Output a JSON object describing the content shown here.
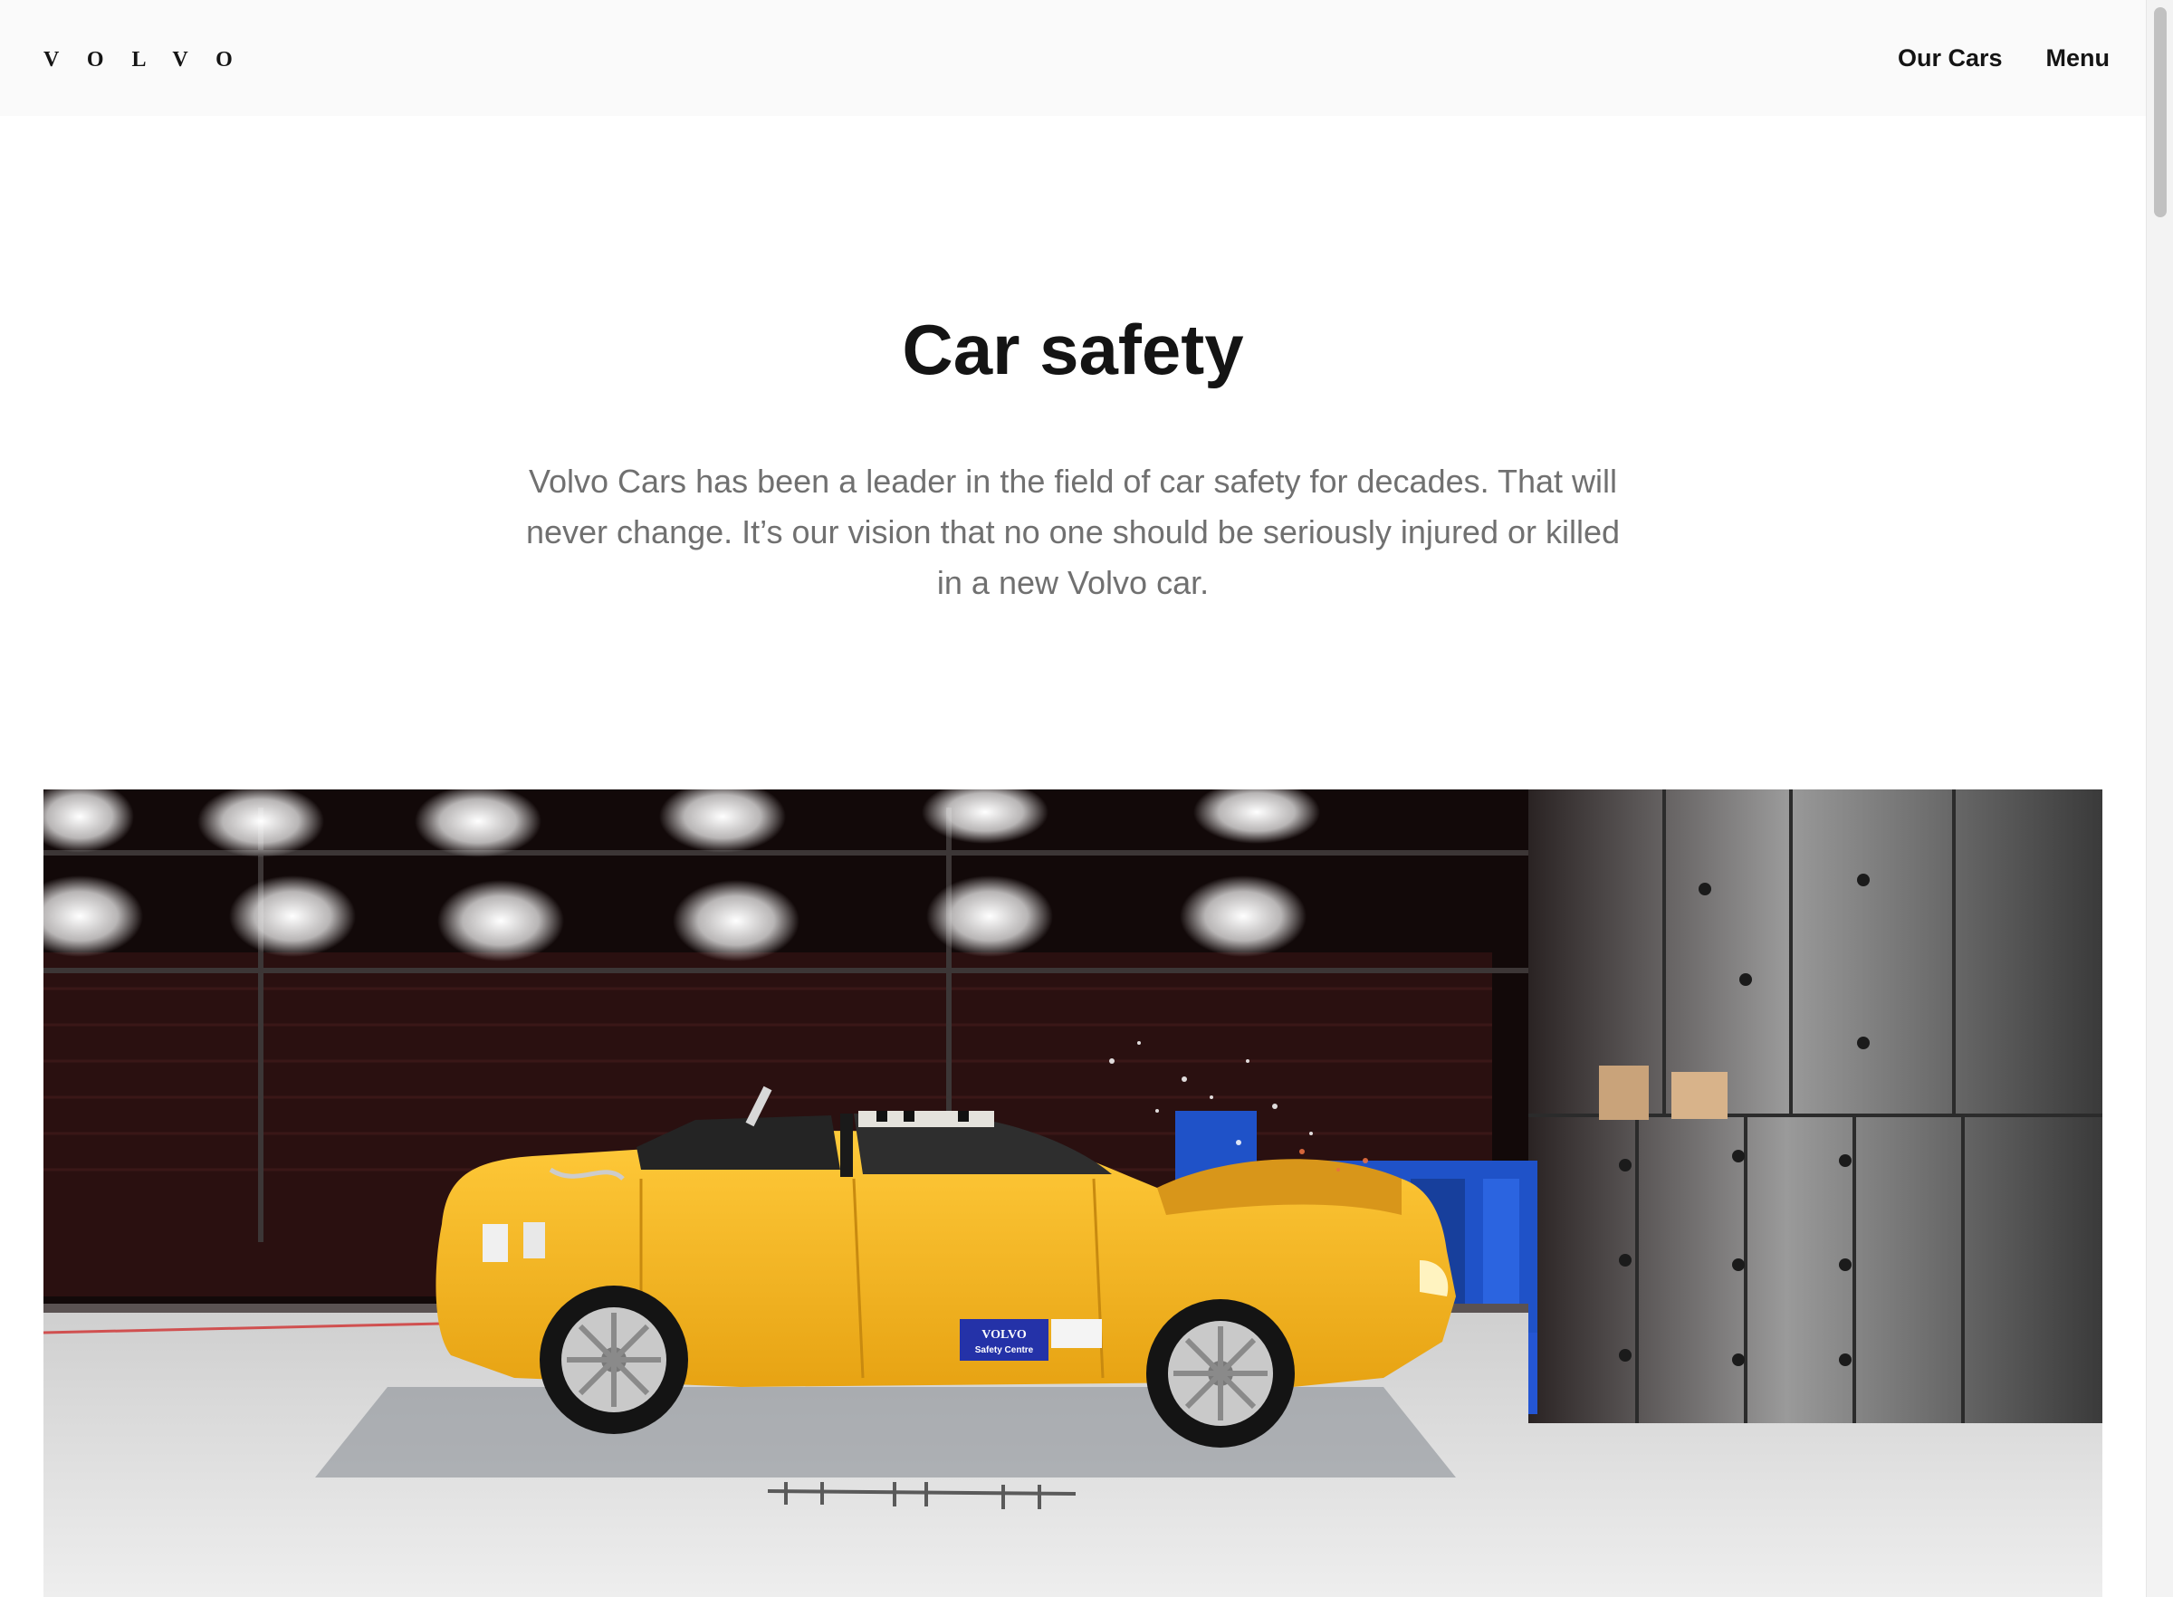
{
  "header": {
    "logo_text": "VOLVO",
    "nav": [
      {
        "label": "Our Cars"
      },
      {
        "label": "Menu"
      }
    ]
  },
  "hero": {
    "title": "Car safety",
    "description": "Volvo Cars has been a leader in the field of car safety for decades. That will never change. It’s our vision that no one should be seriously injured or killed in a new Volvo car."
  },
  "image": {
    "badge_line1": "VOLVO",
    "badge_line2": "Safety Centre",
    "car_color": "#f5b51f",
    "barrier_color": "#1f52c8"
  }
}
